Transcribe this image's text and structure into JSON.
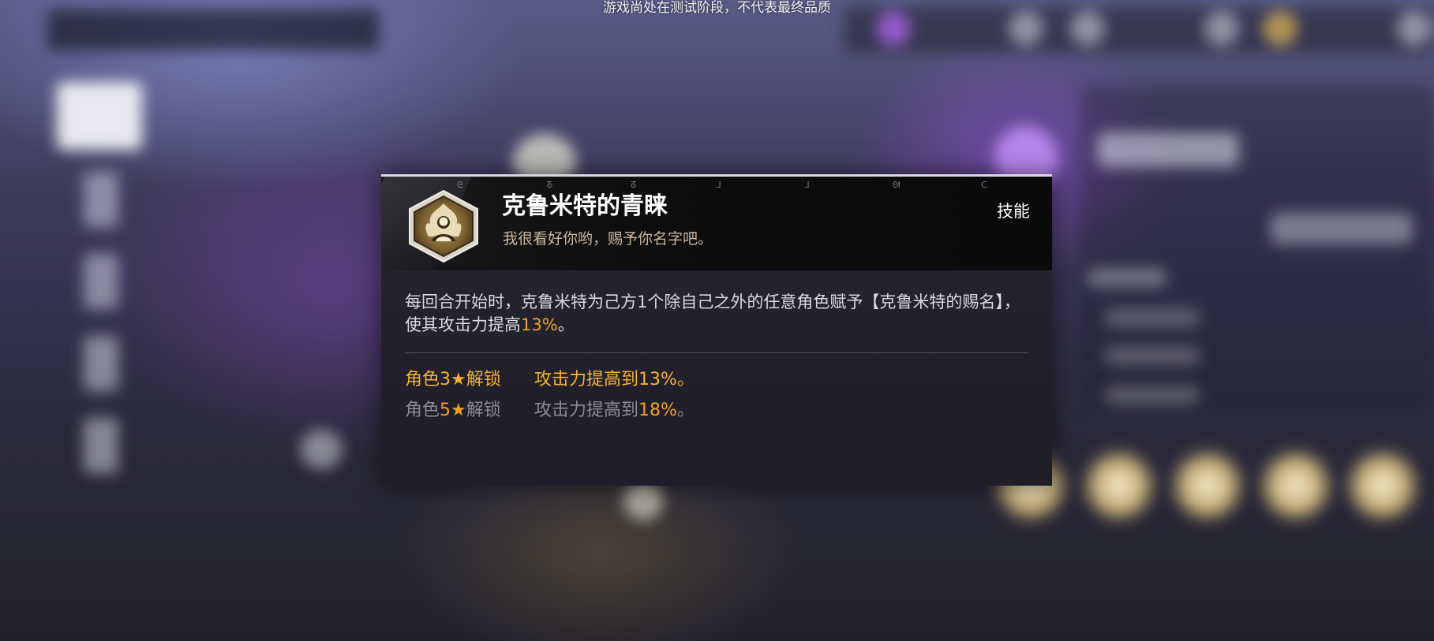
{
  "banner": {
    "text": "游戏尚处在测试阶段，不代表最终品质"
  },
  "skill_popup": {
    "name": "克鲁米特的青睐",
    "quote": "我很看好你哟，赐予你名字吧。",
    "type_label": "技能",
    "icon": "flaming-figure-hexagon-icon",
    "description": {
      "part1": "每回合开始时，克鲁米特为己方1个除自己之外的任意角色赋予【克鲁米特的赐名】，使其攻击力提高",
      "value": "13%",
      "part2": "。"
    },
    "unlocks": [
      {
        "prefix": "角色",
        "stars": "3★",
        "suffix": "解锁",
        "effect_text": "攻击力提高到",
        "effect_value": "13%",
        "effect_end": "。",
        "active": true
      },
      {
        "prefix": "角色",
        "stars": "5★",
        "suffix": "解锁",
        "effect_text": "攻击力提高到",
        "effect_value": "18%",
        "effect_end": "。",
        "active": false
      }
    ]
  },
  "colors": {
    "highlight": "#f0a02e",
    "active_unlock": "#f2b23a",
    "inactive_unlock": "#8d8c95",
    "header_bg": "#0d0d0e",
    "body_bg": "#23222c"
  }
}
